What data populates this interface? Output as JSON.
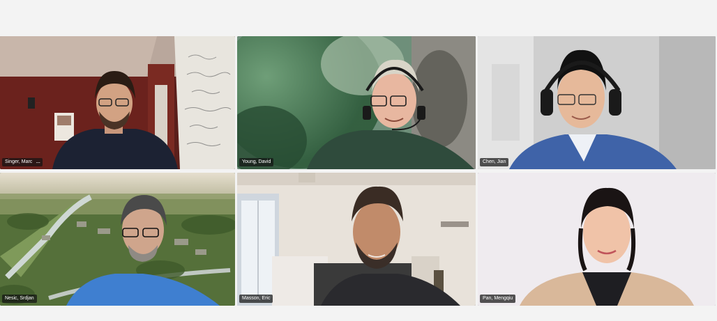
{
  "meeting": {
    "participants": [
      {
        "name": "Singer, Marc",
        "show_more": true
      },
      {
        "name": "Young, David",
        "show_more": false
      },
      {
        "name": "Chen, Jian",
        "show_more": false
      },
      {
        "name": "Nesic, Srdjan",
        "show_more": false
      },
      {
        "name": "Masson, Eric",
        "show_more": false
      },
      {
        "name": "Pan, Mengqiu",
        "show_more": false
      }
    ],
    "more_options_glyph": "···"
  },
  "colors": {
    "page_background": "#f3f3f3",
    "nametag_background": "#141414",
    "nametag_text": "#ffffff"
  },
  "icons": [
    "more-options-icon"
  ]
}
